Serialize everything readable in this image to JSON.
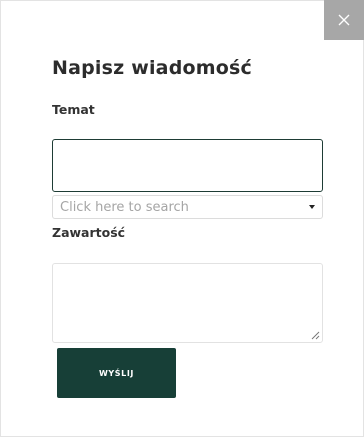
{
  "modal": {
    "title": "Napisz wiadomość",
    "close_icon": "close-icon"
  },
  "form": {
    "subject_label": "Temat",
    "subject_value": "",
    "search_placeholder": "Click here to search",
    "content_label": "Zawartość",
    "content_value": "",
    "submit_label": "WYŚLIJ"
  },
  "colors": {
    "accent": "#173f37",
    "close_bg": "#a7a7a7",
    "input_focus_border": "#1e3c35"
  }
}
